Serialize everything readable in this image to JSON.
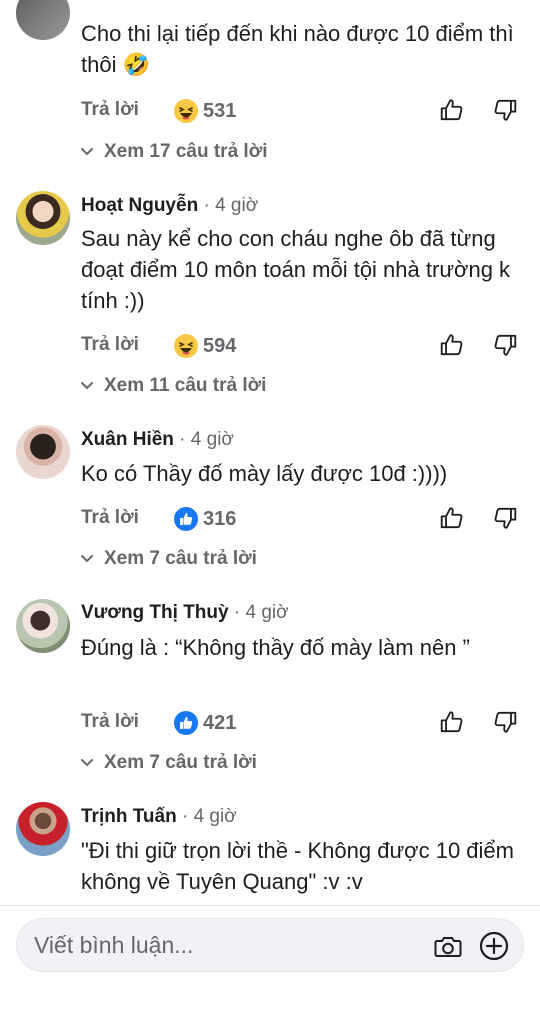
{
  "comments": [
    {
      "name": "",
      "time": "",
      "text": "Cho thi lại tiếp đến khi nào được 10 điểm thì thôi 🤣",
      "reply_label": "Trả lời",
      "reaction_icon": "haha-icon",
      "reaction_count": "531",
      "see_replies": "Xem 17 câu trả lời"
    },
    {
      "name": "Hoạt Nguyễn",
      "time": " · 4 giờ",
      "text": "Sau này kể cho con cháu nghe ôb đã từng đoạt điểm 10 môn toán mỗi tội nhà trường k tính :))",
      "reply_label": "Trả lời",
      "reaction_icon": "haha-icon",
      "reaction_count": "594",
      "see_replies": "Xem 11 câu trả lời"
    },
    {
      "name": "Xuân Hiền",
      "time": " · 4 giờ",
      "text": "Ko có Thầy đố mày lấy được 10đ :))))",
      "reply_label": "Trả lời",
      "reaction_icon": "like-icon",
      "reaction_count": "316",
      "see_replies": "Xem 7 câu trả lời"
    },
    {
      "name": "Vương Thị Thuỳ",
      "time": " · 4 giờ",
      "text": "Đúng là : “Không thầy đố mày làm nên ”",
      "reply_label": "Trả lời",
      "reaction_icon": "like-icon",
      "reaction_count": "421",
      "see_replies": "Xem 7 câu trả lời"
    },
    {
      "name": "Trịnh Tuấn",
      "time": " · 4 giờ",
      "text": "\"Đi thi giữ trọn lời thề - Không được 10 điểm không về Tuyên Quang\" :v :v"
    }
  ],
  "composer": {
    "placeholder": "Viết bình luận..."
  },
  "colors": {
    "text": "#1c1e21",
    "secondary": "#65676b",
    "like_blue": "#1877f2",
    "haha_yellow": "#f7c843"
  }
}
